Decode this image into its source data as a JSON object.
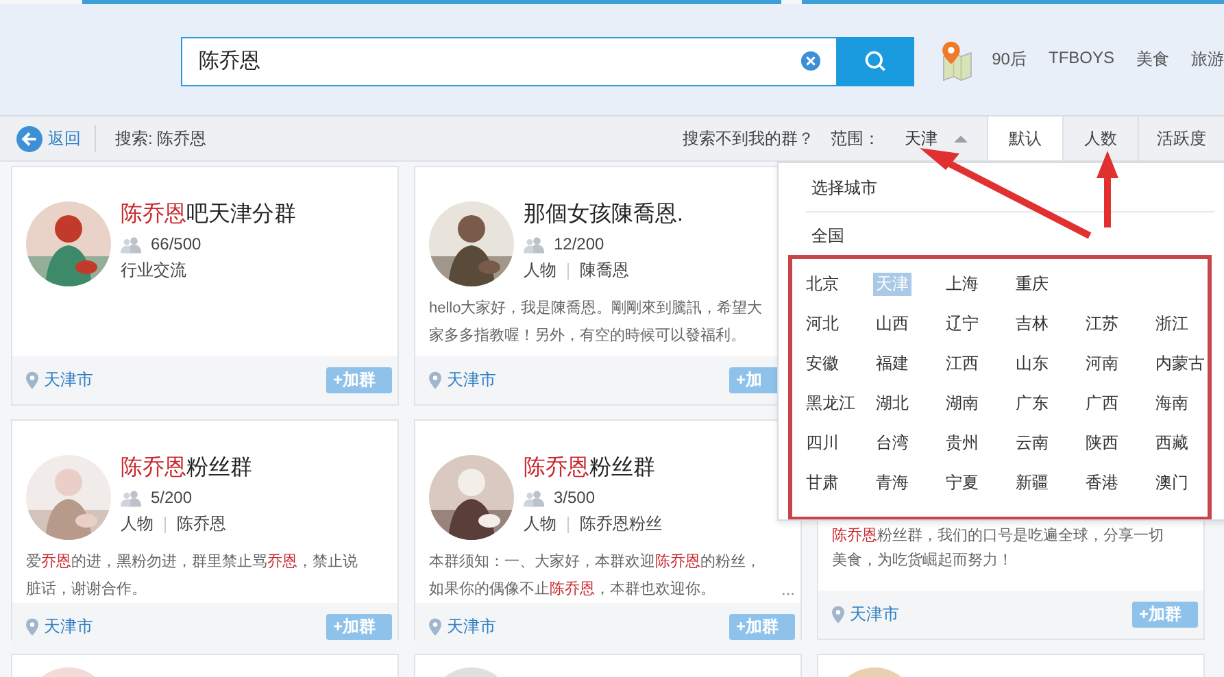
{
  "search": {
    "value": "陈乔恩"
  },
  "hot_tags": [
    "90后",
    "TFBOYS",
    "美食",
    "旅游"
  ],
  "toolbar": {
    "back": "返回",
    "query": "搜索: 陈乔恩",
    "help": "搜索不到我的群？",
    "range_label": "范围：",
    "range_value": "天津",
    "range_expanded": true,
    "sorts": [
      {
        "label": "默认",
        "selected": true
      },
      {
        "label": "人数",
        "selected": false
      },
      {
        "label": "活跃度",
        "selected": false
      }
    ]
  },
  "cards": [
    {
      "title": [
        {
          "text": "陈乔恩",
          "match": true
        },
        {
          "text": "吧天津分群",
          "match": false
        }
      ],
      "members": "66/500",
      "tags": [
        "行业交流"
      ],
      "location": "天津市",
      "join": "+加群"
    },
    {
      "title": [
        {
          "text": "那個女孩陳喬恩.",
          "match": false
        }
      ],
      "members": "12/200",
      "tags": [
        "人物",
        "陳喬恩"
      ],
      "description": [
        {
          "text": "hello大家好，我是陳喬恩。剛剛來到騰訊，希望大家多多指教喔！另外，有空的時候可以發福利。",
          "match": false
        }
      ],
      "location": "天津市",
      "join": "+加"
    },
    {
      "kind": "hidden"
    },
    {
      "title": [
        {
          "text": "陈乔恩",
          "match": true
        },
        {
          "text": "粉丝群",
          "match": false
        }
      ],
      "members": "5/200",
      "tags": [
        "人物",
        "陈乔恩"
      ],
      "description": [
        {
          "text": "爱",
          "match": false
        },
        {
          "text": "乔恩",
          "match": true
        },
        {
          "text": "的进，黑粉勿进，群里禁止骂",
          "match": false
        },
        {
          "text": "乔恩",
          "match": true
        },
        {
          "text": "，禁止说脏话，谢谢合作。",
          "match": false
        }
      ],
      "location": "天津市",
      "join": "+加群"
    },
    {
      "title": [
        {
          "text": "陈乔恩",
          "match": true
        },
        {
          "text": "粉丝群",
          "match": false
        }
      ],
      "members": "3/500",
      "tags": [
        "人物",
        "陈乔恩粉丝"
      ],
      "description": [
        {
          "text": "本群须知：一、大家好，本群欢迎",
          "match": false
        },
        {
          "text": "陈乔恩",
          "match": true
        },
        {
          "text": "的粉丝，如果你的偶像不止",
          "match": false
        },
        {
          "text": "陈乔恩",
          "match": true
        },
        {
          "text": "，本群也欢迎你。",
          "match": false
        }
      ],
      "more": "...",
      "location": "天津市",
      "join": "+加群"
    },
    {
      "kind": "covered",
      "description": [
        {
          "text": "陈乔恩",
          "match": true
        },
        {
          "text": "粉丝群，我们的口号是吃遍全球，分享一切美食，为吃货崛起而努力！",
          "match": false
        }
      ],
      "location": "天津市",
      "join": "+加群"
    },
    {
      "kind": "cut"
    },
    {
      "kind": "cut"
    },
    {
      "kind": "cut"
    }
  ],
  "city_picker": {
    "title": "选择城市",
    "all": "全国",
    "rows": [
      [
        {
          "label": "北京",
          "selected": false
        },
        {
          "label": "天津",
          "selected": true
        },
        {
          "label": "上海",
          "selected": false
        },
        {
          "label": "重庆",
          "selected": false
        }
      ],
      [
        {
          "label": "河北",
          "selected": false
        },
        {
          "label": "山西",
          "selected": false
        },
        {
          "label": "辽宁",
          "selected": false
        },
        {
          "label": "吉林",
          "selected": false
        },
        {
          "label": "江苏",
          "selected": false
        },
        {
          "label": "浙江",
          "selected": false
        }
      ],
      [
        {
          "label": "安徽",
          "selected": false
        },
        {
          "label": "福建",
          "selected": false
        },
        {
          "label": "江西",
          "selected": false
        },
        {
          "label": "山东",
          "selected": false
        },
        {
          "label": "河南",
          "selected": false
        },
        {
          "label": "内蒙古",
          "selected": false
        }
      ],
      [
        {
          "label": "黑龙江",
          "selected": false
        },
        {
          "label": "湖北",
          "selected": false
        },
        {
          "label": "湖南",
          "selected": false
        },
        {
          "label": "广东",
          "selected": false
        },
        {
          "label": "广西",
          "selected": false
        },
        {
          "label": "海南",
          "selected": false
        }
      ],
      [
        {
          "label": "四川",
          "selected": false
        },
        {
          "label": "台湾",
          "selected": false
        },
        {
          "label": "贵州",
          "selected": false
        },
        {
          "label": "云南",
          "selected": false
        },
        {
          "label": "陕西",
          "selected": false
        },
        {
          "label": "西藏",
          "selected": false
        }
      ],
      [
        {
          "label": "甘肃",
          "selected": false
        },
        {
          "label": "青海",
          "selected": false
        },
        {
          "label": "宁夏",
          "selected": false
        },
        {
          "label": "新疆",
          "selected": false
        },
        {
          "label": "香港",
          "selected": false
        },
        {
          "label": "澳门",
          "selected": false
        }
      ]
    ]
  }
}
